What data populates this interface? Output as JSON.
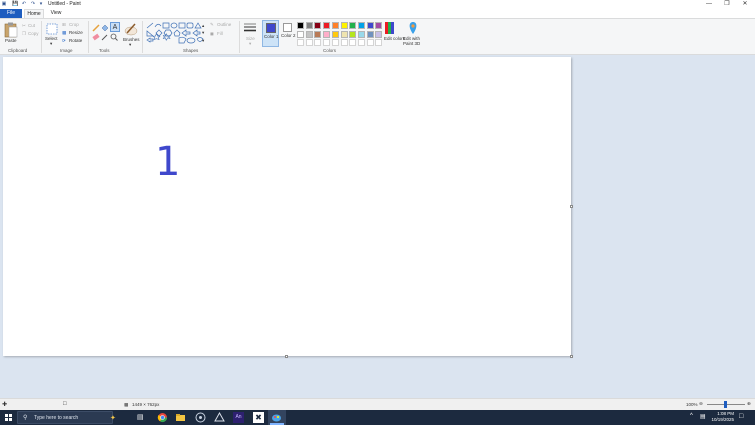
{
  "window": {
    "title": "Untitled - Paint",
    "minimize": "—",
    "maximize": "❐",
    "close": "✕"
  },
  "tabs": {
    "file": "File",
    "home": "Home",
    "view": "View"
  },
  "ribbon": {
    "clipboard": {
      "label": "Clipboard",
      "paste": "Paste",
      "cut": "Cut",
      "copy": "Copy"
    },
    "image": {
      "label": "Image",
      "select": "Select",
      "crop": "Crop",
      "resize": "Resize",
      "rotate": "Rotate"
    },
    "tools": {
      "label": "Tools"
    },
    "brushes": {
      "label": "Brushes"
    },
    "shapes": {
      "label": "Shapes",
      "outline": "Outline",
      "fill": "Fill"
    },
    "size": {
      "label": "Size"
    },
    "colors": {
      "label": "Colors",
      "color1": "Color 1",
      "color2": "Color 2",
      "edit_colors": "Edit colors",
      "edit_paint3d": "Edit with Paint 3D",
      "color1_value": "#3f48cc",
      "color2_value": "#ffffff",
      "palette_row1": [
        "#000000",
        "#7f7f7f",
        "#880015",
        "#ed1c24",
        "#ff7f27",
        "#fff200",
        "#22b14c",
        "#00a2e8",
        "#3f48cc",
        "#a349a4"
      ],
      "palette_row2": [
        "#ffffff",
        "#c3c3c3",
        "#b97a57",
        "#ffaec9",
        "#ffc90e",
        "#efe4b0",
        "#b5e61d",
        "#99d9ea",
        "#7092be",
        "#c8bfe7"
      ],
      "palette_row3": [
        "#ffffff",
        "#ffffff",
        "#ffffff",
        "#ffffff",
        "#ffffff",
        "#ffffff",
        "#ffffff",
        "#ffffff",
        "#ffffff",
        "#ffffff"
      ]
    }
  },
  "canvas": {
    "drawn_text": "1"
  },
  "status": {
    "image_size": "1449 × 762px",
    "zoom": "100%"
  },
  "taskbar": {
    "search_placeholder": "Type here to search",
    "time": "1:08 PM",
    "date": "10/19/2025"
  }
}
